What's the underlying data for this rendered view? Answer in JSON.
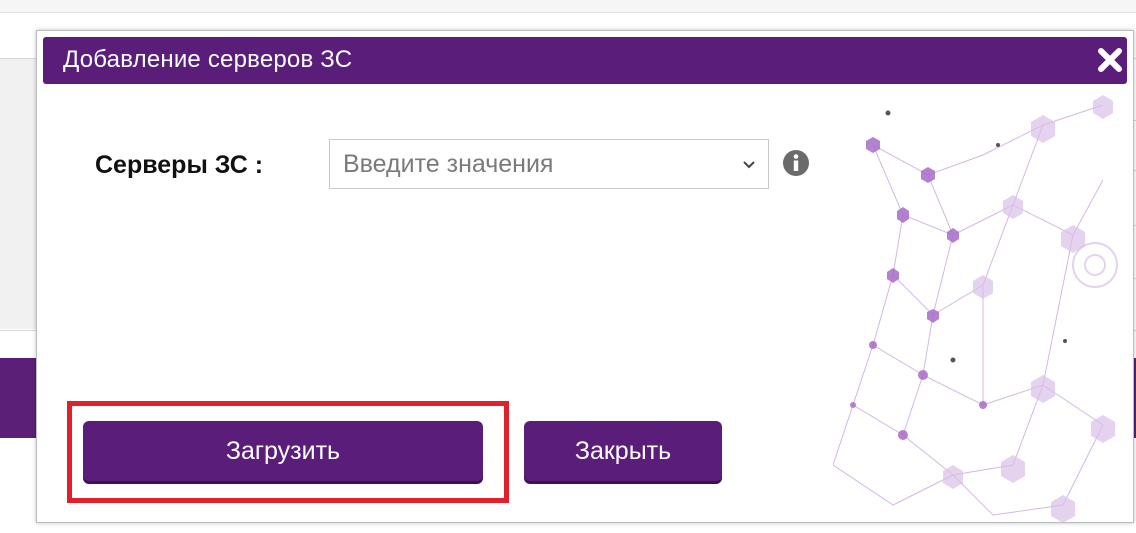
{
  "modal": {
    "title": "Добавление серверов ЗС",
    "field_label": "Серверы ЗС :",
    "field_placeholder": "Введите значения",
    "load_button": "Загрузить",
    "close_button": "Закрыть"
  },
  "colors": {
    "header": "#5a1e7a",
    "button": "#5a1e7a",
    "highlight": "#e0202a"
  },
  "icons": {
    "close": "close-icon",
    "caret": "chevron-down-icon",
    "info": "info-icon"
  }
}
